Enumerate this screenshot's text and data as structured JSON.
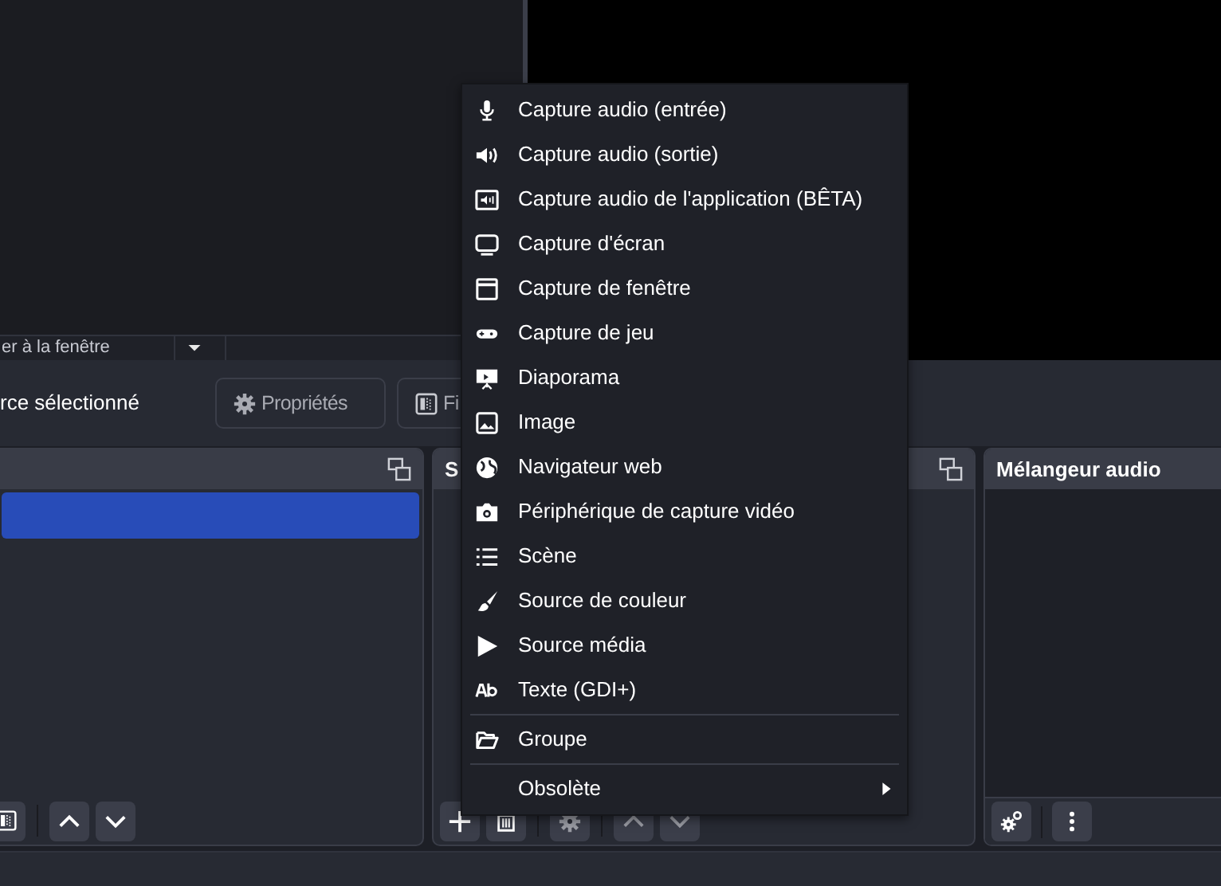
{
  "preview": {
    "scale_label": "er à la fenêtre"
  },
  "source_toolbar": {
    "status": "rce sélectionné",
    "buttons": [
      {
        "label": "Propriétés"
      },
      {
        "label": "Fi"
      }
    ]
  },
  "docks": [
    {
      "kind": "scenes",
      "rows": [
        {
          "selected": true
        }
      ]
    },
    {
      "kind": "sources",
      "title": "S"
    },
    {
      "kind": "mixer",
      "title": "Mélangeur audio"
    }
  ],
  "menu": {
    "sections": [
      [
        {
          "label": "Capture audio (entrée)",
          "kind": "action"
        },
        {
          "label": "Capture audio (sortie)",
          "kind": "action"
        },
        {
          "label": "Capture audio de l'application (BÊTA)",
          "kind": "action"
        },
        {
          "label": "Capture d'écran",
          "kind": "action"
        },
        {
          "label": "Capture de fenêtre",
          "kind": "action"
        },
        {
          "label": "Capture de jeu",
          "kind": "action"
        },
        {
          "label": "Diaporama",
          "kind": "action"
        },
        {
          "label": "Image",
          "kind": "action"
        },
        {
          "label": "Navigateur web",
          "kind": "action"
        },
        {
          "label": "Périphérique de capture vidéo",
          "kind": "action"
        },
        {
          "label": "Scène",
          "kind": "action"
        },
        {
          "label": "Source de couleur",
          "kind": "action"
        },
        {
          "label": "Source média",
          "kind": "action"
        },
        {
          "label": "Texte (GDI+)",
          "kind": "action"
        }
      ],
      [
        {
          "label": "Groupe",
          "kind": "action"
        }
      ],
      [
        {
          "label": "Obsolète",
          "kind": "submenu"
        }
      ]
    ]
  }
}
